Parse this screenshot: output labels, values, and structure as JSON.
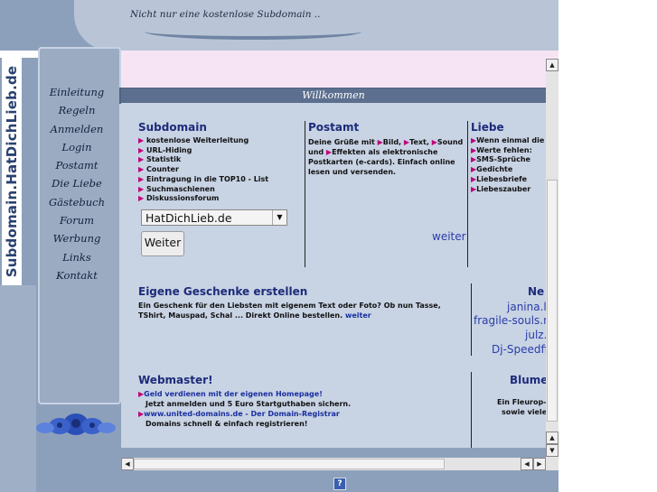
{
  "header": {
    "tagline": "Nicht nur eine kostenlose Subdomain .."
  },
  "site_title": "Subdomain.HatDichLieb.de",
  "nav": [
    "Einleitung",
    "Regeln",
    "Anmelden",
    "Login",
    "Postamt",
    "Die Liebe",
    "Gästebuch",
    "Forum",
    "Werbung",
    "Links",
    "Kontakt"
  ],
  "welcome": "Willkommen",
  "subdomain": {
    "title": "Subdomain",
    "items": [
      "kostenlose Weiterleitung",
      "URL-Hiding",
      "Statistik",
      "Counter",
      "Eintragung in die TOP10 - List",
      "Suchmaschienen",
      "Diskussionsforum"
    ],
    "select_value": "HatDichLieb.de",
    "button": "Weiter"
  },
  "postamt": {
    "title": "Postamt",
    "text_parts": [
      "Deine Grüße mit",
      "Bild,",
      "Text,",
      "Sound und",
      "Effekten als elektronische Postkarten (e-cards). Einfach online lesen und versenden."
    ],
    "link": "weiter"
  },
  "liebe": {
    "title": "Liebe",
    "items": [
      "Wenn einmal die",
      "Werte fehlen:",
      "SMS-Sprüche",
      "Gedichte",
      "Liebesbriefe",
      "Liebeszauber"
    ]
  },
  "geschenke": {
    "title": "Eigene Geschenke erstellen",
    "text": "Ein Geschenk für den Liebsten mit eigenem Text oder Foto? Ob nun Tasse, TShirt, Mauspad, Schal ... Direkt Online bestellen.",
    "link": "weiter"
  },
  "neu": {
    "title": "Ne",
    "users": [
      "janina.l",
      "fragile-souls.n",
      "julz.",
      "Dj-Speedfi"
    ]
  },
  "webmaster": {
    "title": "Webmaster!",
    "link1": "Geld verdienen mit der eigenen Homepage!",
    "text1": "Jetzt anmelden und 5 Euro Startguthaben sichern.",
    "link2": "www.united-domains.de - Der Domain-Registrar",
    "text2": "Domains schnell & einfach registrieren!"
  },
  "blumen": {
    "title": "Blume",
    "text1": "Ein Fleurop-",
    "text2": "sowie viele"
  },
  "bottom_icon": "?",
  "colors": {
    "frame": "#8da0bb",
    "content": "#c8d3e4",
    "title_blue": "#1d2b7a",
    "arrow": "#c0007a"
  }
}
